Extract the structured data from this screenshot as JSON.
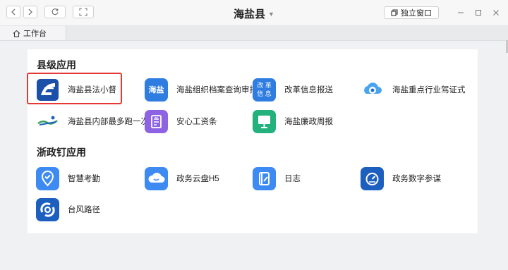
{
  "window": {
    "title": "海盐县",
    "independent_window_label": "独立窗口"
  },
  "tabs": [
    {
      "label": "工作台"
    }
  ],
  "sections": [
    {
      "title": "县级应用",
      "apps": [
        {
          "label": "海盐县法小督",
          "icon": "fa-xiao-du-logo"
        },
        {
          "label": "海盐组织档案查询审批",
          "icon": "haiyan-text-icon",
          "icon_text": "海盐"
        },
        {
          "label": "改革信息报送",
          "icon": "gaige-xinxi-icon",
          "icon_text": "改 革 信 息"
        },
        {
          "label": "海盐重点行业驾证式",
          "icon": "cloud-swirl-icon"
        },
        {
          "label": "海盐县内部最多跑一次",
          "icon": "run-once-logo"
        },
        {
          "label": "安心工资条",
          "icon": "payslip-icon"
        },
        {
          "label": "海盐廉政周报",
          "icon": "monitor-icon"
        }
      ]
    },
    {
      "title": "浙政钉应用",
      "apps": [
        {
          "label": "智慧考勤",
          "icon": "location-check-icon"
        },
        {
          "label": "政务云盘H5",
          "icon": "cloud-icon"
        },
        {
          "label": "日志",
          "icon": "journal-edit-icon"
        },
        {
          "label": "政务数字参谋",
          "icon": "gauge-icon"
        },
        {
          "label": "台风路径",
          "icon": "typhoon-icon"
        }
      ]
    }
  ],
  "colors": {
    "highlight": "#e53935",
    "blue": "#3d8bf2",
    "purple": "#8e63e3",
    "green": "#23b27e",
    "navy": "#1c5fbf"
  }
}
